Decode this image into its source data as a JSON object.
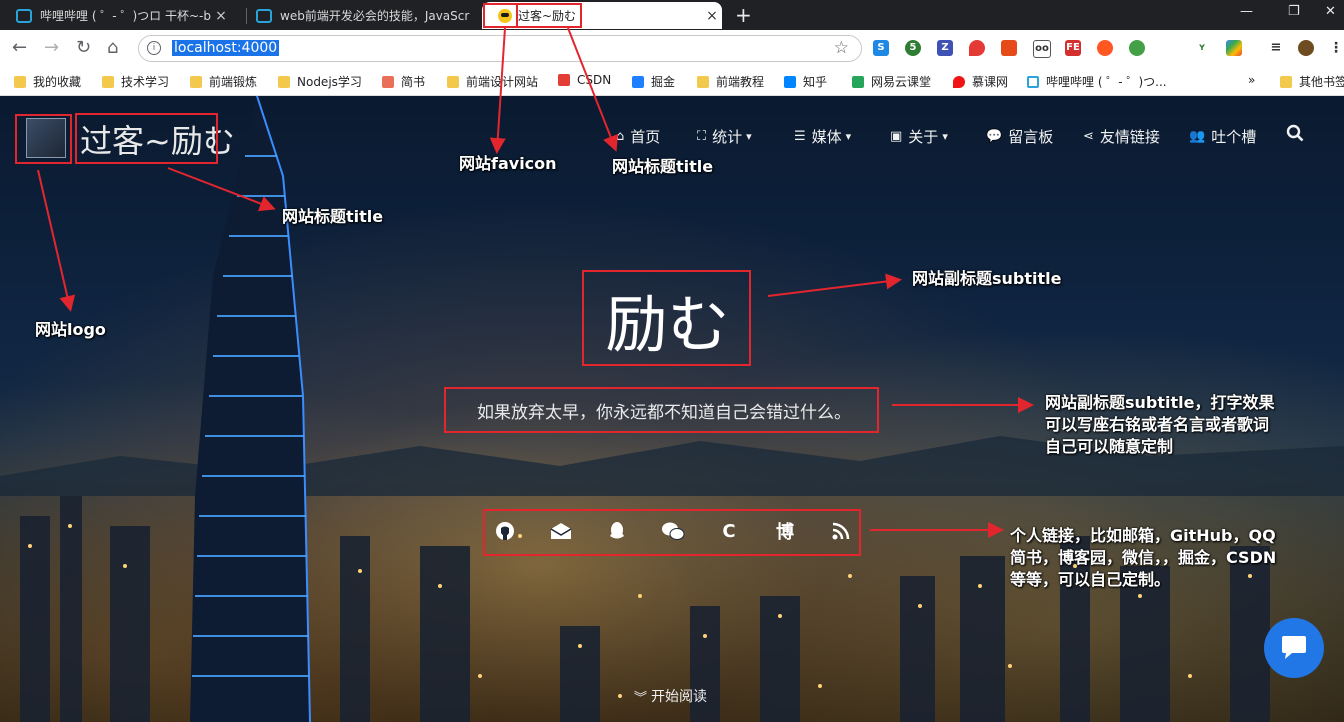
{
  "browser": {
    "tabs": [
      {
        "title": "哔哩哔哩 ( ゜- ゜)つロ 干杯~-bilibili",
        "active": false
      },
      {
        "title": "web前端开发必会的技能，JavaScript",
        "active": false
      },
      {
        "title": "过客~励む",
        "active": true
      }
    ],
    "new_tab": "+",
    "close_glyph": "×",
    "window_controls": [
      "—",
      "❐",
      "✕"
    ],
    "url": "localhost:4000",
    "bookmarks": [
      "我的收藏",
      "技术学习",
      "前端锻炼",
      "Nodejs学习",
      "简书",
      "前端设计网站",
      "CSDN",
      "掘金",
      "前端教程",
      "知乎",
      "网易云课堂",
      "慕课网",
      "哔哩哔哩 ( ゜- ゜)つ...",
      "»",
      "其他书签"
    ]
  },
  "site": {
    "title": "过客~励む",
    "subtitle": "励む",
    "motto": "如果放弃太早，你永远都不知道自己会错过什么。",
    "read_more": "开始阅读",
    "menu": [
      "首页",
      "统计",
      "媒体",
      "关于",
      "留言板",
      "友情链接",
      "吐个槽"
    ],
    "socials": [
      "github-icon",
      "mail-icon",
      "qq-icon",
      "wechat-icon",
      "C",
      "博",
      "rss-icon"
    ]
  },
  "annotations": {
    "favicon": "网站favicon",
    "tab_title": "网站标题title",
    "header_title": "网站标题title",
    "logo": "网站logo",
    "subtitle": "网站副标题subtitle",
    "motto_lines": [
      "网站副标题subtitle，打字效果",
      "可以写座右铭或者名言或者歌词",
      "自己可以随意定制"
    ],
    "links_lines": [
      "个人链接，比如邮箱，GitHub，QQ",
      "简书，博客园，微信，，掘金，CSDN",
      "等等，可以自己定制。"
    ]
  },
  "colors": {
    "annotation_red": "#e3262e",
    "chat_blue": "#2277e6",
    "url_highlight": "#1a73e8"
  }
}
